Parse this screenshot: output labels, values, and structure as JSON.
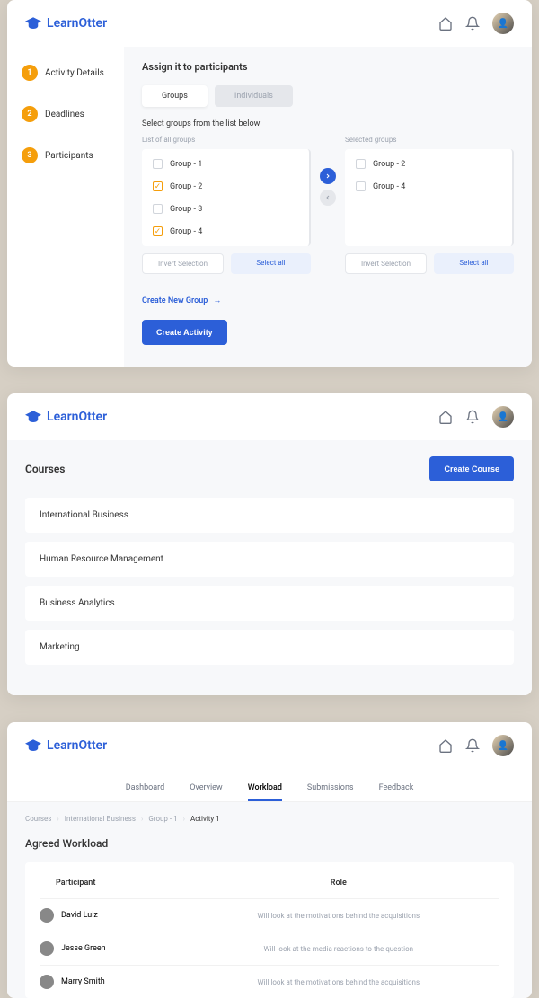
{
  "brand": "LearnOtter",
  "card1": {
    "steps": [
      {
        "n": "1",
        "label": "Activity Details"
      },
      {
        "n": "2",
        "label": "Deadlines"
      },
      {
        "n": "3",
        "label": "Participants"
      }
    ],
    "title": "Assign it to participants",
    "tabGroups": "Groups",
    "tabIndividuals": "Individuals",
    "selectLabel": "Select groups from the list below",
    "leftHeader": "List of all groups",
    "rightHeader": "Selected groups",
    "leftItems": [
      {
        "label": "Group - 1",
        "checked": false
      },
      {
        "label": "Group - 2",
        "checked": true
      },
      {
        "label": "Group - 3",
        "checked": false
      },
      {
        "label": "Group - 4",
        "checked": true
      }
    ],
    "rightItems": [
      {
        "label": "Group - 2",
        "checked": false
      },
      {
        "label": "Group - 4",
        "checked": false
      }
    ],
    "invert": "Invert Selection",
    "selectAll": "Select all",
    "createGroup": "Create New Group",
    "createActivity": "Create Activity"
  },
  "card2": {
    "title": "Courses",
    "createBtn": "Create Course",
    "items": [
      "International Business",
      "Human Resource Management",
      "Business Analytics",
      "Marketing"
    ]
  },
  "card3": {
    "tabs": [
      "Dashboard",
      "Overview",
      "Workload",
      "Submissions",
      "Feedback"
    ],
    "activeTab": "Workload",
    "breadcrumb": [
      "Courses",
      "International Business",
      "Group - 1",
      "Activity 1"
    ],
    "title": "Agreed Workload",
    "colParticipant": "Participant",
    "colRole": "Role",
    "rows": [
      {
        "name": "David Luiz",
        "role": "Will look at the motivations behind the acquisitions"
      },
      {
        "name": "Jesse Green",
        "role": "Will look at the media reactions to the question"
      },
      {
        "name": "Marry Smith",
        "role": "Will look at the motivations behind the acquisitions"
      }
    ]
  }
}
